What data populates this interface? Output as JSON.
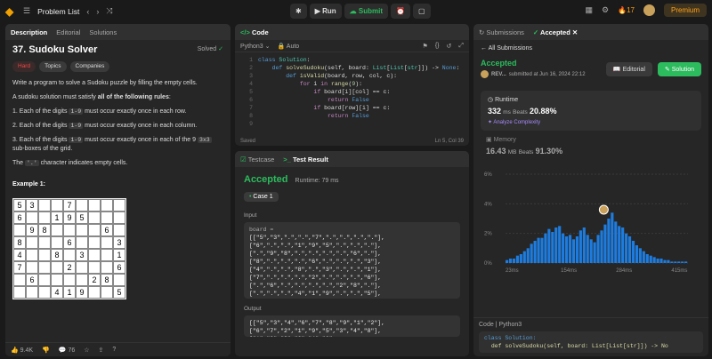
{
  "topbar": {
    "title": "Problem List",
    "run_label": "Run",
    "submit_label": "Submit",
    "premium_label": "Premium",
    "streak": "17"
  },
  "desc": {
    "tabs": [
      "Description",
      "Editorial",
      "Solutions"
    ],
    "title": "37. Sudoku Solver",
    "solved": "Solved",
    "tags": [
      "Hard",
      "Topics",
      "Companies"
    ],
    "p1": "Write a program to solve a Sudoku puzzle by filling the empty cells.",
    "p2a": "A sudoku solution must satisfy ",
    "p2b": "all of the following rules",
    "r1a": "Each of the digits ",
    "r1c": "1-9",
    "r1b": " must occur exactly once in each row.",
    "r2a": "Each of the digits ",
    "r2c": "1-9",
    "r2b": " must occur exactly once in each column.",
    "r3a": "Each of the digits ",
    "r3c": "1-9",
    "r3b": " must occur exactly once in each of the 9 ",
    "r3c2": "3x3",
    "r3d": " sub-boxes of the grid.",
    "p3a": "The ",
    "p3c": "'.'",
    "p3b": " character indicates empty cells.",
    "example": "Example 1:",
    "grid": [
      [
        "5",
        "3",
        "",
        "",
        "7",
        "",
        "",
        "",
        ""
      ],
      [
        "6",
        "",
        "",
        "1",
        "9",
        "5",
        "",
        "",
        ""
      ],
      [
        "",
        "9",
        "8",
        "",
        "",
        "",
        "",
        "6",
        ""
      ],
      [
        "8",
        "",
        "",
        "",
        "6",
        "",
        "",
        "",
        "3"
      ],
      [
        "4",
        "",
        "",
        "8",
        "",
        "3",
        "",
        "",
        "1"
      ],
      [
        "7",
        "",
        "",
        "",
        "2",
        "",
        "",
        "",
        "6"
      ],
      [
        "",
        "6",
        "",
        "",
        "",
        "",
        "2",
        "8",
        ""
      ],
      [
        "",
        "",
        "",
        "4",
        "1",
        "9",
        "",
        "",
        "5"
      ]
    ],
    "likes": "9.4K",
    "comments": "76"
  },
  "code": {
    "tab": "Code",
    "lang": "Python3",
    "auto": "Auto",
    "saved": "Saved",
    "pos": "Ln 5, Col 39"
  },
  "result": {
    "tabs": [
      "Testcase",
      "Test Result"
    ],
    "status": "Accepted",
    "runtime": "Runtime: 79 ms",
    "case": "Case 1",
    "input_label": "Input",
    "var": "board =",
    "input": "[[\"5\",\"3\",\".\",\".\",\"7\",\".\",\".\",\".\",\".\"],[\"6\",\".\",\".\",\"1\",\"9\",\"5\",\".\",\".\",\".\"],[\".\",\"9\",\"8\",\".\",\".\",\".\",\".\",\"6\",\".\"],[\"8\",\".\",\".\",\".\",\"6\",\".\",\".\",\".\",\"3\"],[\"4\",\".\",\".\",\"8\",\".\",\"3\",\".\",\".\",\"1\"],[\"7\",\".\",\".\",\".\",\"2\",\".\",\".\",\".\",\"6\"],[\".\",\"6\",\".\",\".\",\".\",\".\",\"2\",\"8\",\".\"],[\".\",\".\",\".\",\"4\",\"1\",\"9\",\".\",\".\",\"5\"],[\".\",\".\",\".\",\".\",\"8\",\".\",\".\",\"7\",\"9\"]]",
    "output_label": "Output",
    "output": "[[\"5\",\"3\",\"4\",\"6\",\"7\",\"8\",\"9\",\"1\",\"2\"],[\"6\",\"7\",\"2\",\"1\",\"9\",\"5\",\"3\",\"4\",\"8\"],[\"1\",\"9\",\"8\",\"3\",\"4\",\"2\""
  },
  "sub": {
    "tabs": [
      "Submissions",
      "Accepted"
    ],
    "back": "All Submissions",
    "status": "Accepted",
    "user": "REV...",
    "when": "submitted at Jun 16, 2024 22:12",
    "editorial": "Editorial",
    "solution": "Solution",
    "rt_label": "Runtime",
    "rt": "332",
    "ms": "ms",
    "beats": "Beats",
    "beats_pct": "20.88%",
    "analyze": "Analyze Complexity",
    "mem_label": "Memory",
    "mem": "16.43",
    "mb": "MB",
    "mem_pct": "91.30%",
    "code_label": "Code",
    "lang": "Python3",
    "code_line1": "class Solution:",
    "code_line2": "def solveSudoku(self, board: List[List[str]]) -> No"
  },
  "chart_data": {
    "type": "bar",
    "series": [
      {
        "name": "runtime distribution",
        "values": [
          0.2,
          0.3,
          0.3,
          0.5,
          0.6,
          0.8,
          1.0,
          1.3,
          1.5,
          1.7,
          1.7,
          2.0,
          2.3,
          2.1,
          2.4,
          2.5,
          2.0,
          1.8,
          1.9,
          1.6,
          1.8,
          2.2,
          2.4,
          1.9,
          1.6,
          1.4,
          1.9,
          2.2,
          2.6,
          3.0,
          3.4,
          2.8,
          2.5,
          2.4,
          2.0,
          1.8,
          1.5,
          1.2,
          1.0,
          0.8,
          0.6,
          0.5,
          0.4,
          0.3,
          0.3,
          0.2,
          0.2,
          0.1,
          0.1,
          0.1,
          0.1,
          0.1
        ]
      }
    ],
    "yticks": [
      "6%",
      "4%",
      "2%",
      "0%"
    ],
    "xticks": [
      "23ms",
      "154ms",
      "284ms",
      "415ms"
    ],
    "ylim": [
      0,
      6
    ]
  }
}
